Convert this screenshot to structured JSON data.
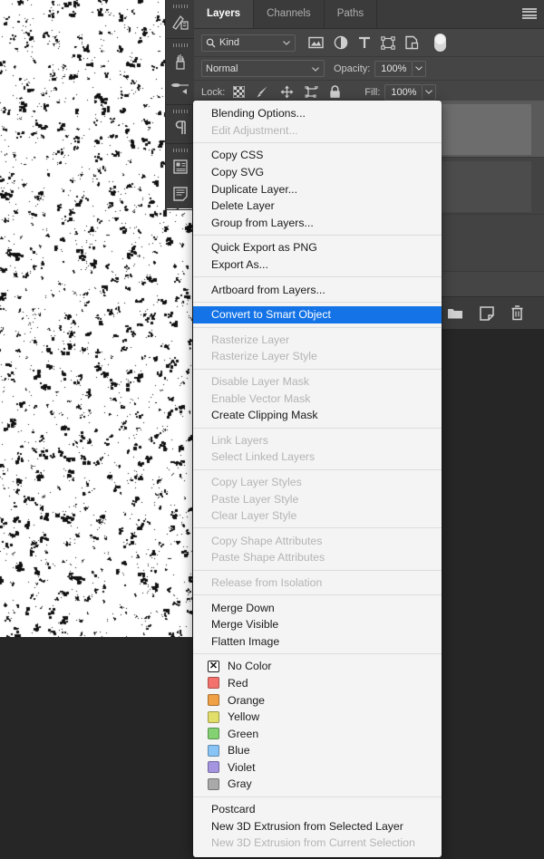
{
  "canvas": {
    "name": "document-canvas",
    "pattern": "halftone-grain-texture",
    "bg": "#ffffff"
  },
  "dock": {
    "items": [
      {
        "name": "dock-item-history",
        "icon": "history-panel-icon"
      },
      {
        "name": "dock-item-brushes",
        "icon": "brushes-panel-icon"
      },
      {
        "name": "dock-item-brush-presets",
        "icon": "brush-presets-icon"
      },
      {
        "name": "dock-item-paragraph",
        "icon": "paragraph-panel-icon"
      },
      {
        "name": "dock-item-properties",
        "icon": "properties-panel-icon"
      },
      {
        "name": "dock-item-notes",
        "icon": "notes-panel-icon"
      }
    ]
  },
  "panel": {
    "tabs": [
      {
        "label": "Layers",
        "active": true
      },
      {
        "label": "Channels",
        "active": false
      },
      {
        "label": "Paths",
        "active": false
      }
    ],
    "menu_icon": "hamburger-menu-icon",
    "filter": {
      "kind_label": "Kind",
      "search_icon": "search-icon",
      "caret_icon": "chevron-down-icon",
      "icons": [
        {
          "name": "filter-pixel-layers-icon",
          "title": "Pixel layers"
        },
        {
          "name": "filter-adjustment-layers-icon",
          "title": "Adjustment layers"
        },
        {
          "name": "filter-type-layers-icon",
          "title": "Type layers"
        },
        {
          "name": "filter-shape-layers-icon",
          "title": "Shape layers"
        },
        {
          "name": "filter-smart-objects-icon",
          "title": "Smart objects"
        }
      ],
      "toggle_name": "filter-enable-toggle"
    },
    "blend": {
      "mode": "Normal",
      "opacity_label": "Opacity:",
      "opacity_value": "100%",
      "caret_icon": "chevron-down-icon"
    },
    "lock": {
      "label": "Lock:",
      "icons": [
        {
          "name": "lock-transparent-pixels-icon"
        },
        {
          "name": "lock-image-pixels-icon"
        },
        {
          "name": "lock-position-icon"
        },
        {
          "name": "lock-artboard-nesting-icon"
        },
        {
          "name": "lock-all-icon"
        }
      ],
      "fill_label": "Fill:",
      "fill_value": "100%"
    },
    "layers": [
      {
        "name": "layer-row-1",
        "selected": true
      },
      {
        "name": "layer-row-2",
        "selected": false
      },
      {
        "name": "layer-row-3",
        "selected": false
      }
    ],
    "footer_icons": [
      {
        "name": "link-layers-icon"
      },
      {
        "name": "layer-style-icon"
      },
      {
        "name": "add-layer-mask-icon"
      },
      {
        "name": "new-adjustment-layer-icon"
      },
      {
        "name": "new-group-icon"
      },
      {
        "name": "new-layer-icon"
      },
      {
        "name": "delete-layer-icon"
      }
    ]
  },
  "context_menu": {
    "highlight_color": "#1473e6",
    "groups": [
      {
        "items": [
          {
            "label": "Blending Options...",
            "state": "enabled"
          },
          {
            "label": "Edit Adjustment...",
            "state": "disabled"
          }
        ]
      },
      {
        "items": [
          {
            "label": "Copy CSS",
            "state": "enabled"
          },
          {
            "label": "Copy SVG",
            "state": "enabled"
          },
          {
            "label": "Duplicate Layer...",
            "state": "enabled"
          },
          {
            "label": "Delete Layer",
            "state": "enabled"
          },
          {
            "label": "Group from Layers...",
            "state": "enabled"
          }
        ]
      },
      {
        "items": [
          {
            "label": "Quick Export as PNG",
            "state": "enabled"
          },
          {
            "label": "Export As...",
            "state": "enabled"
          }
        ]
      },
      {
        "items": [
          {
            "label": "Artboard from Layers...",
            "state": "enabled"
          }
        ]
      },
      {
        "items": [
          {
            "label": "Convert to Smart Object",
            "state": "highlight"
          }
        ]
      },
      {
        "items": [
          {
            "label": "Rasterize Layer",
            "state": "disabled"
          },
          {
            "label": "Rasterize Layer Style",
            "state": "disabled"
          }
        ]
      },
      {
        "items": [
          {
            "label": "Disable Layer Mask",
            "state": "disabled"
          },
          {
            "label": "Enable Vector Mask",
            "state": "disabled"
          },
          {
            "label": "Create Clipping Mask",
            "state": "enabled"
          }
        ]
      },
      {
        "items": [
          {
            "label": "Link Layers",
            "state": "disabled"
          },
          {
            "label": "Select Linked Layers",
            "state": "disabled"
          }
        ]
      },
      {
        "items": [
          {
            "label": "Copy Layer Styles",
            "state": "disabled"
          },
          {
            "label": "Paste Layer Style",
            "state": "disabled"
          },
          {
            "label": "Clear Layer Style",
            "state": "disabled"
          }
        ]
      },
      {
        "items": [
          {
            "label": "Copy Shape Attributes",
            "state": "disabled"
          },
          {
            "label": "Paste Shape Attributes",
            "state": "disabled"
          }
        ]
      },
      {
        "items": [
          {
            "label": "Release from Isolation",
            "state": "disabled"
          }
        ]
      },
      {
        "items": [
          {
            "label": "Merge Down",
            "state": "enabled"
          },
          {
            "label": "Merge Visible",
            "state": "enabled"
          },
          {
            "label": "Flatten Image",
            "state": "enabled"
          }
        ]
      },
      {
        "items": [
          {
            "label": "No Color",
            "state": "enabled",
            "swatch": "none"
          },
          {
            "label": "Red",
            "state": "enabled",
            "swatch": "#f4726d"
          },
          {
            "label": "Orange",
            "state": "enabled",
            "swatch": "#f0a045"
          },
          {
            "label": "Yellow",
            "state": "enabled",
            "swatch": "#e2de6a"
          },
          {
            "label": "Green",
            "state": "enabled",
            "swatch": "#83d173"
          },
          {
            "label": "Blue",
            "state": "enabled",
            "swatch": "#88c4f5"
          },
          {
            "label": "Violet",
            "state": "enabled",
            "swatch": "#a595e0"
          },
          {
            "label": "Gray",
            "state": "enabled",
            "swatch": "#a9a9a9"
          }
        ]
      },
      {
        "items": [
          {
            "label": "Postcard",
            "state": "enabled"
          },
          {
            "label": "New 3D Extrusion from Selected Layer",
            "state": "enabled"
          },
          {
            "label": "New 3D Extrusion from Current Selection",
            "state": "disabled"
          }
        ]
      }
    ]
  }
}
